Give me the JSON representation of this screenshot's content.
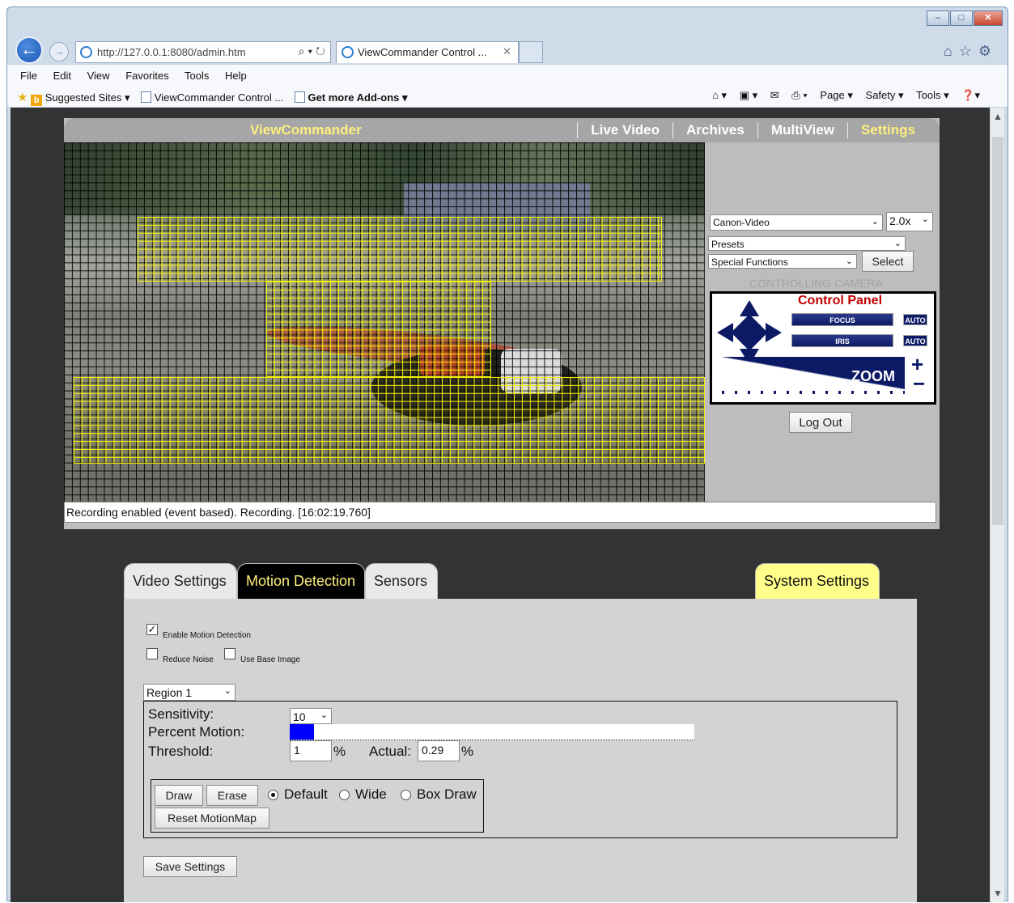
{
  "browser": {
    "address": "http://127.0.0.1:8080/admin.htm",
    "address_host": "127.0.0.1",
    "tab_title": "ViewCommander Control ...",
    "menu": [
      "File",
      "Edit",
      "View",
      "Favorites",
      "Tools",
      "Help"
    ],
    "favorites": {
      "suggested": "Suggested Sites ▾",
      "viewcommander": "ViewCommander Control ...",
      "addons": "Get more Add-ons ▾"
    },
    "commands": {
      "page": "Page ▾",
      "safety": "Safety ▾",
      "tools": "Tools ▾"
    }
  },
  "app": {
    "brand": "ViewCommander",
    "nav": [
      "Live Video",
      "Archives",
      "MultiView",
      "Settings"
    ],
    "active_nav": "Settings",
    "camera_select": "Canon-Video",
    "zoom_select": "2.0x",
    "presets_select": "Presets",
    "special_select": "Special Functions",
    "select_button": "Select",
    "controlling_caption": "CONTROLLING CAMERA",
    "control_panel": {
      "title": "Control Panel",
      "focus": "FOCUS",
      "iris": "IRIS",
      "auto": "AUTO",
      "zoom": "ZOOM",
      "plus": "+",
      "minus": "−"
    },
    "logout_button": "Log Out",
    "status": "Recording enabled (event based). Recording. [16:02:19.760]"
  },
  "settings": {
    "tabs": [
      "Video Settings",
      "Motion Detection",
      "Sensors"
    ],
    "active_tab": "Motion Detection",
    "system_tab": "System Settings",
    "enable_motion": {
      "label": "Enable Motion Detection",
      "checked": true
    },
    "reduce_noise": {
      "label": "Reduce Noise",
      "checked": false
    },
    "use_base_image": {
      "label": "Use Base Image",
      "checked": false
    },
    "region_select": "Region 1",
    "sensitivity_label": "Sensitivity:",
    "sensitivity_value": "10",
    "percent_motion_label": "Percent Motion:",
    "percent_motion_fill": 6,
    "threshold_label": "Threshold:",
    "threshold_value": "1",
    "percent_sign": "%",
    "actual_label": "Actual:",
    "actual_value": "0.29",
    "draw_button": "Draw",
    "erase_button": "Erase",
    "mode_default": "Default",
    "mode_wide": "Wide",
    "mode_box": "Box Draw",
    "selected_mode": "Default",
    "reset_button": "Reset MotionMap",
    "save_button": "Save Settings"
  },
  "colors": {
    "accent_yellow": "#ffef7e",
    "grid_yellow": "#f3f000",
    "control_navy": "#0c1a66",
    "control_title_red": "#c00000"
  }
}
